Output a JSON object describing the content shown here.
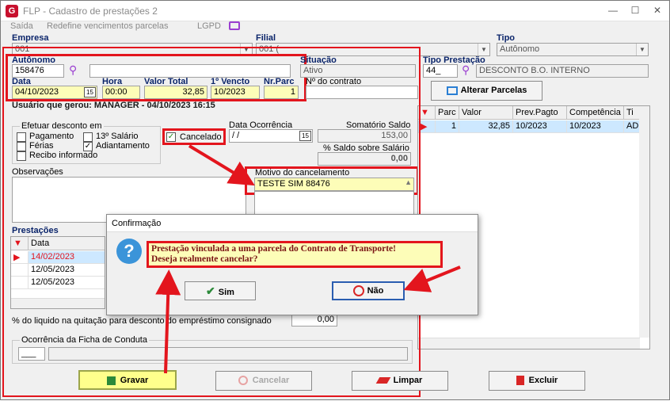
{
  "window": {
    "app_title": "FLP - Cadastro de prestações 2",
    "logo_letter": "G"
  },
  "menu": {
    "items": [
      "Saída",
      "Redefine vencimentos parcelas",
      "LGPD"
    ]
  },
  "form": {
    "empresa_label": "Empresa",
    "empresa_value": "001",
    "filial_label": "Filial",
    "filial_value": "001 (",
    "tipo_label": "Tipo",
    "tipo_value": "Autônomo",
    "autonomo_label": "Autônomo",
    "autonomo_code": "158476",
    "situacao_label": "Situação",
    "situacao_value": "Ativo",
    "tipo_prestacao_label": "Tipo Prestação",
    "tipo_prestacao_code": "44_",
    "tipo_prestacao_desc": "DESCONTO B.O. INTERNO",
    "data_label": "Data",
    "data_value": "04/10/2023",
    "date_btn": "15",
    "hora_label": "Hora",
    "hora_value": "00:00",
    "valor_total_label": "Valor Total",
    "valor_total_value": "32,85",
    "primeiro_vencto_label": "1º Vencto",
    "primeiro_vencto_value": "10/2023",
    "nr_parc_label": "Nr.Parc",
    "nr_parc_value": "1",
    "contrato_label": "Nº do contrato",
    "contrato_value": "",
    "alterar_parcelas_label": "Alterar Parcelas",
    "usuario_gerou": "Usuário que gerou: MANAGER - 04/10/2023 16:15",
    "efetuar_desconto_label": "Efetuar desconto em",
    "chk_pagamento": "Pagamento",
    "chk_13salario": "13º Salário",
    "chk_ferias": "Férias",
    "chk_adiantamento": "Adiantamento",
    "chk_recibo": "Recibo informado",
    "chk_cancelado": "Cancelado",
    "check_mark": "✓",
    "data_ocorrencia_label": "Data Ocorrência",
    "data_ocorrencia_value": " / /",
    "somatorio_label": "Somatório Saldo",
    "somatorio_value": "153,00",
    "saldo_salario_label": "% Saldo sobre Salário",
    "saldo_salario_value": "0,00",
    "observacoes_label": "Observações",
    "motivo_label": "Motivo do cancelamento",
    "motivo_value": "TESTE SIM 88476",
    "prestacoes_label": "Prestações",
    "perc_liquido_label": "% do liquido na quitação para desconto do empréstimo consignado",
    "perc_liquido_value": "0,00",
    "ocorrencia_ficha_label": "Ocorrência da Ficha de Conduta",
    "ocorrencia_value": "___"
  },
  "parcelas_grid": {
    "headers": [
      "Parc",
      "Valor",
      "Prev.Pagto",
      "Competência",
      "Ti"
    ],
    "rows": [
      {
        "parc": "1",
        "valor": "32,85",
        "prev": "10/2023",
        "comp": "10/2023",
        "ti": "AD"
      }
    ]
  },
  "prestacoes_grid": {
    "header": "Data",
    "rows": [
      "14/02/2023",
      "12/05/2023",
      "12/05/2023"
    ]
  },
  "buttons": {
    "gravar": "Gravar",
    "cancelar": "Cancelar",
    "limpar": "Limpar",
    "excluir": "Excluir"
  },
  "dialog": {
    "title": "Confirmação",
    "line1": "Prestação vinculada a uma parcela do Contrato de Transporte!",
    "line2": "Deseja realmente cancelar?",
    "sim": "Sim",
    "nao": "Não"
  },
  "colors": {
    "highlight_red": "#e3151d",
    "field_yellow": "#fdfdb8",
    "accent_blue": "#0a246a"
  }
}
